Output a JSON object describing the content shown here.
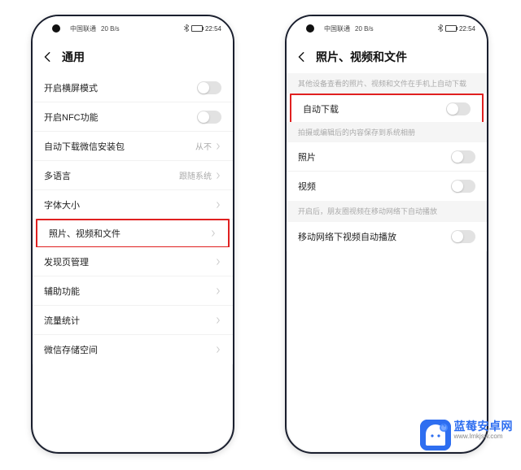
{
  "status_bar": {
    "carrier": "中国联通",
    "speed": "20 B/s",
    "time": "22:54",
    "battery_icon_label": "电池"
  },
  "left": {
    "title": "通用",
    "rows": [
      {
        "label": "开启横屏模式",
        "type": "toggle",
        "on": false
      },
      {
        "label": "开启NFC功能",
        "type": "toggle",
        "on": false
      },
      {
        "label": "自动下载微信安装包",
        "type": "value",
        "value": "从不"
      },
      {
        "label": "多语言",
        "type": "value",
        "value": "跟随系统"
      },
      {
        "label": "字体大小",
        "type": "nav"
      },
      {
        "label": "照片、视频和文件",
        "type": "nav",
        "highlight": true
      },
      {
        "label": "发现页管理",
        "type": "nav"
      },
      {
        "label": "辅助功能",
        "type": "nav"
      },
      {
        "label": "流量统计",
        "type": "nav"
      },
      {
        "label": "微信存储空间",
        "type": "nav"
      }
    ]
  },
  "right": {
    "title": "照片、视频和文件",
    "sections": [
      {
        "header": "其他设备查看的照片、视频和文件在手机上自动下载",
        "rows": [
          {
            "label": "自动下载",
            "type": "toggle",
            "on": false,
            "highlight": true
          }
        ]
      },
      {
        "header": "拍摄或编辑后的内容保存到系统相册",
        "rows": [
          {
            "label": "照片",
            "type": "toggle",
            "on": false
          },
          {
            "label": "视频",
            "type": "toggle",
            "on": false
          }
        ]
      },
      {
        "header": "开启后，朋友圈视频在移动网络下自动播放",
        "rows": [
          {
            "label": "移动网络下视频自动播放",
            "type": "toggle",
            "on": false
          }
        ]
      }
    ]
  },
  "branding": {
    "title": "蓝莓安卓网",
    "url": "www.lmkjsw.com"
  },
  "icons": {
    "back": "back-icon",
    "chevron": "chevron-right-icon",
    "signal": "signal-icon",
    "wifi": "wifi-icon",
    "battery": "battery-icon"
  }
}
